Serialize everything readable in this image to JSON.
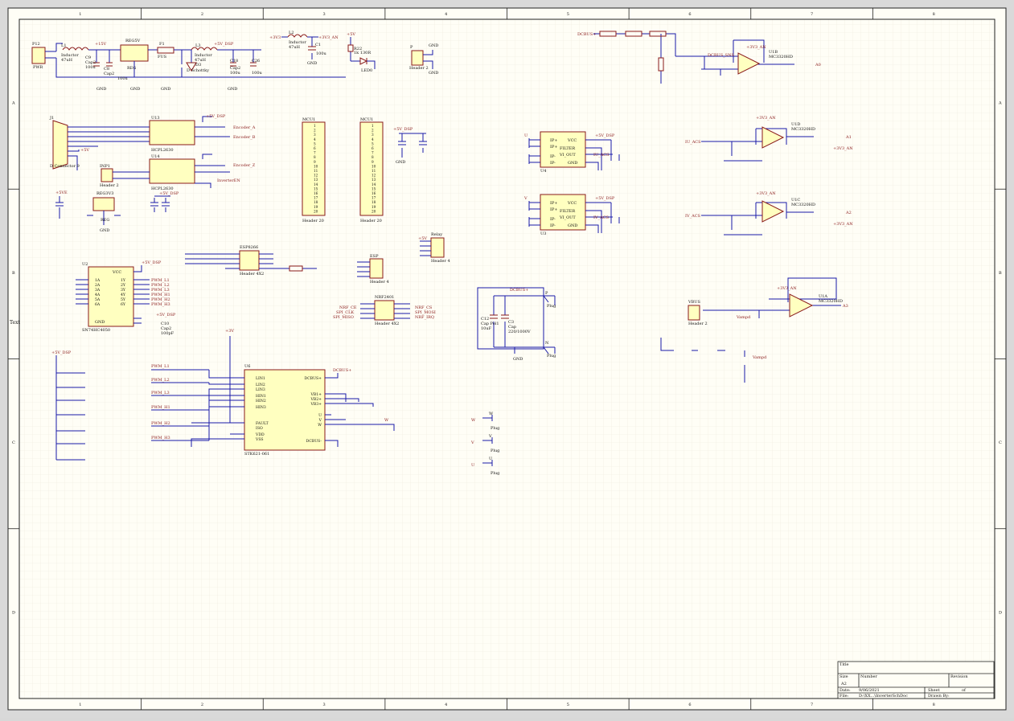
{
  "colors": {
    "paper": "#fffef6",
    "outer": "#d9d9d9",
    "grid": "#eeeade",
    "border": "#222222",
    "wire": "#1a1aa8",
    "component": "#8a1a1a",
    "fill": "#ffffc0",
    "label": "#8a1a1a",
    "text": "#111111"
  },
  "border": {
    "columns": [
      "1",
      "2",
      "3",
      "4",
      "5",
      "6",
      "7",
      "8"
    ],
    "rows": [
      "A",
      "B",
      "C",
      "D"
    ]
  },
  "title_block": {
    "title_label": "Title",
    "size_label": "Size",
    "size_value": "A2",
    "number_label": "Number",
    "revision_label": "Revision",
    "date_label": "Date:",
    "date_value": "9/06/2021",
    "file_label": "File:",
    "file_value": "D:\\XX...\\InverterSchDoc",
    "sheet_label": "Sheet",
    "sheet_of": "of",
    "drawn_label": "Drawn By:"
  },
  "left_edge_label": "Text",
  "components": {
    "p12": {
      "ref": "P12",
      "value": "PWR"
    },
    "l1": {
      "ref": "L1",
      "value": "Inductor",
      "value2": "47uH"
    },
    "c9": {
      "ref": "C9",
      "value": "Cap2",
      "value2": "100u"
    },
    "c8": {
      "ref": "C8",
      "value": "Cap2",
      "value2": "100u"
    },
    "reg5v": {
      "ref": "REG5V",
      "value": "REG"
    },
    "f1": {
      "ref": "F1",
      "value": "FUS"
    },
    "l3": {
      "ref": "L3",
      "value": "Inductor",
      "value2": "47uH"
    },
    "d3": {
      "ref": "D3",
      "value": "D Schottky"
    },
    "c18": {
      "ref": "C18",
      "value": "Cap2",
      "value2": "100u"
    },
    "c26": {
      "ref": "C26",
      "value": "100u"
    },
    "l2": {
      "ref": "L2",
      "value": "Inductor",
      "value2": "47uH"
    },
    "c1": {
      "ref": "C1",
      "value": "100u"
    },
    "r22": {
      "ref": "R22",
      "value": "1k 130R"
    },
    "led0": {
      "ref": "LED0"
    },
    "p": {
      "ref": "P",
      "value": "Header 2"
    },
    "j1": {
      "ref": "J1",
      "value": "D Connector 9"
    },
    "u13": {
      "ref": "U13",
      "value": "HCPL2630"
    },
    "u14": {
      "ref": "U14",
      "value": "HCPL2630"
    },
    "inp1": {
      "ref": "INP1",
      "value": "Header 2"
    },
    "mcu1": {
      "ref": "MCU1",
      "value": "Header 20"
    },
    "mcu2": {
      "ref": "MCU1",
      "value": "Header 20"
    },
    "u4": {
      "ref": "U4",
      "l1": "IP+",
      "l2": "IP+",
      "l3": "IP-",
      "l4": "IP-",
      "r1": "VCC",
      "r2": "FILTER",
      "r3": "VI_OUT",
      "r4": "GND"
    },
    "u3": {
      "ref": "U3",
      "l1": "IP+",
      "l2": "IP+",
      "l3": "IP-",
      "l4": "IP-",
      "r1": "VCC",
      "r2": "FILTER",
      "r3": "VI_OUT",
      "r4": "GND"
    },
    "u1b": {
      "ref": "U1B",
      "value": "MC3320HD"
    },
    "u1d": {
      "ref": "U1D",
      "value": "MC3320HD"
    },
    "u1c": {
      "ref": "U1C",
      "value": "MC3320HD"
    },
    "u1a": {
      "ref": "U1A",
      "value": "MC3320HD"
    },
    "reg3v3": {
      "ref": "REG3V3",
      "value": "REG"
    },
    "esp8266": {
      "ref": "ESP8266",
      "value": "Header 4X2"
    },
    "esp": {
      "ref": "ESP",
      "value": "Header 4"
    },
    "relay": {
      "ref": "Relay",
      "value": "Header 4"
    },
    "nrf2401": {
      "ref": "NRF2401",
      "value": "Header 4X2"
    },
    "u2": {
      "ref": "U2",
      "value": "SN74HC4050",
      "vcc": "VCC",
      "gnd": "GND"
    },
    "u6": {
      "ref": "U6",
      "value": "STK621-061"
    },
    "c12": {
      "ref": "C12",
      "value": "Cap Pol1",
      "value2": "10uF"
    },
    "c3": {
      "ref": "C3",
      "value": "Cap",
      "value2": "220/1000V"
    },
    "vbus": {
      "ref": "VBUS",
      "value": "Header 2"
    },
    "c10": {
      "ref": "C10",
      "value": "Cap2",
      "value2": "100pF"
    }
  },
  "u6_pins_left": [
    "LIN1",
    "LIN2",
    "LIN3",
    "HIN1",
    "HIN2",
    "HIN3",
    "FAULT",
    "ISO",
    "VDD",
    "VSS"
  ],
  "u6_pins_right": [
    "DCBUS+",
    "VB1+",
    "VB2+",
    "VB3+",
    "U",
    "V",
    "W",
    "DCBUS-"
  ],
  "u2_pins": [
    "1A",
    "2A",
    "3A",
    "4A",
    "5A",
    "6A"
  ],
  "u2_outs": [
    "1Y",
    "2Y",
    "3Y",
    "4Y",
    "5Y",
    "6Y"
  ],
  "nets": {
    "p15v": "+15V",
    "p5v": "+5V",
    "p5v_dsp": "+5V_DSP",
    "p3v3": "+3V3",
    "p3v3_an": "+3V3_AN",
    "p3v": "+3V",
    "gnd": "GND",
    "dcbus_p": "DCBUS+",
    "dcbus_m": "DCBUS-",
    "dcbus_sns": "DCBUS_SNS",
    "encoder_a": "Encoder_A",
    "encoder_b": "Encoder_B",
    "encoder_z": "Encoder_Z",
    "inverter_en": "InverterEN",
    "pwm_l1": "PWM_L1",
    "pwm_l2": "PWM_L2",
    "pwm_l3": "PWM_L3",
    "pwm_h1": "PWM_H1",
    "pwm_h2": "PWM_H2",
    "pwm_h3": "PWM_H3",
    "iu_acs": "IU_ACS",
    "iv_acs": "IV_ACS",
    "nrf_ce": "NRF_CE",
    "spi_clk": "SPI_CLK",
    "spi_miso": "SPI_MISO",
    "nrf_cs": "NRF_CS",
    "spi_mosi": "SPI_MOSI",
    "nrf_irq": "NRF_IRQ",
    "vampd": "Vampd",
    "pwm": "PWM",
    "u": "U",
    "v": "V",
    "w": "W",
    "a0": "A0",
    "a1": "A1",
    "a2": "A2",
    "a3": "A3"
  },
  "plugs": {
    "label": "Plug",
    "p_label": "P",
    "n_label": "N"
  }
}
